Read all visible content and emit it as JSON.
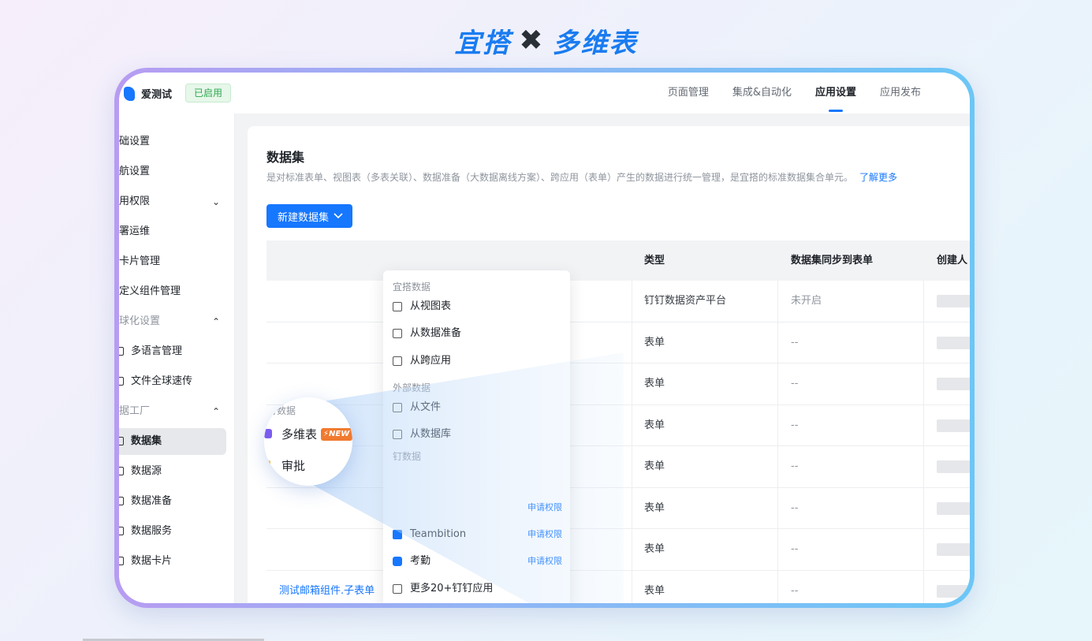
{
  "hero": {
    "brand_left": "宜搭",
    "separator": "✖",
    "brand_right": "多维表"
  },
  "app": {
    "name": "爱测试",
    "status": "已启用"
  },
  "topnav": [
    {
      "label": "页面管理",
      "active": false
    },
    {
      "label": "集成&自动化",
      "active": false
    },
    {
      "label": "应用设置",
      "active": true
    },
    {
      "label": "应用发布",
      "active": false
    }
  ],
  "sidebar": {
    "items": [
      {
        "label": "础设置"
      },
      {
        "label": "航设置"
      },
      {
        "label": "用权限",
        "chevron": "down"
      },
      {
        "label": "署运维"
      },
      {
        "label": "卡片管理"
      },
      {
        "label": "定义组件管理"
      },
      {
        "label": "球化设置",
        "chevron": "up",
        "group": true
      },
      {
        "label": "多语言管理",
        "sub": true
      },
      {
        "label": "文件全球速传",
        "sub": true
      },
      {
        "label": "据工厂",
        "chevron": "up",
        "group": true
      },
      {
        "label": "数据集",
        "sub": true,
        "selected": true
      },
      {
        "label": "数据源",
        "sub": true
      },
      {
        "label": "数据准备",
        "sub": true
      },
      {
        "label": "数据服务",
        "sub": true
      },
      {
        "label": "数据卡片",
        "sub": true
      }
    ]
  },
  "main": {
    "title": "数据集",
    "description": "是对标准表单、视图表（多表关联）、数据准备（大数据离线方案）、跨应用（表单）产生的数据进行统一管理，是宜搭的标准数据集合单元。",
    "learn_more": "了解更多",
    "new_button": "新建数据集"
  },
  "table": {
    "columns": [
      "类型",
      "数据集同步到表单",
      "创建人"
    ],
    "rows": [
      {
        "name": "",
        "type": "钉钉数据资产平台",
        "sync": "未开启"
      },
      {
        "name": "",
        "type": "表单",
        "sync": "--"
      },
      {
        "name": "",
        "type": "表单",
        "sync": "--"
      },
      {
        "name": "",
        "type": "表单",
        "sync": "--"
      },
      {
        "name": "",
        "type": "表单",
        "sync": "--"
      },
      {
        "name": "",
        "type": "表单",
        "sync": "--"
      },
      {
        "name": "",
        "type": "表单",
        "sync": "--"
      },
      {
        "name": "测试邮箱组件.子表单",
        "type": "表单",
        "sync": "--"
      }
    ]
  },
  "dropdown": {
    "group1": "宜搭数据",
    "from_view": "从视图表",
    "from_prep": "从数据准备",
    "from_cross": "从跨应用",
    "group2": "外部数据",
    "from_file": "从文件",
    "from_db": "从数据库",
    "group3": "钉数据",
    "teambition": "Teambition",
    "attendance": "考勤",
    "apply_perm": "申请权限",
    "more": "更多20+钉钉应用"
  },
  "magnifier": {
    "group": "钉数据",
    "multi_table": "多维表",
    "new_badge": "⚡NEW",
    "approval": "审批"
  },
  "colors": {
    "accent": "#1677ff",
    "badge_green": "#2fa84f",
    "new_orange": "#f07a2f"
  }
}
